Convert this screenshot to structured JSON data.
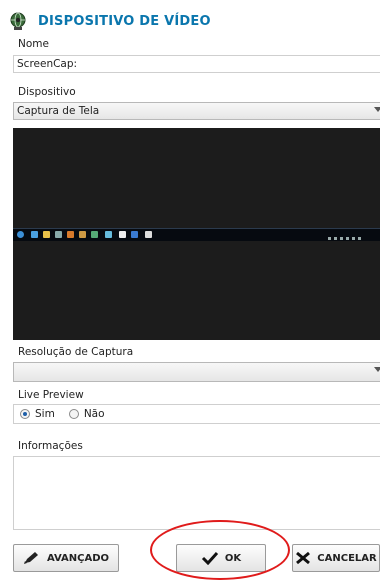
{
  "header": {
    "title": "DISPOSITIVO DE VÍDEO",
    "icon": "webcam-globe-icon"
  },
  "form": {
    "name_label": "Nome",
    "name_value": "ScreenCap:",
    "device_label": "Dispositivo",
    "device_value": "Captura de Tela",
    "resolution_label": "Resolução de Captura",
    "resolution_value": "",
    "live_preview_label": "Live Preview",
    "live_preview_options": [
      "Sim",
      "Não"
    ],
    "live_preview_selected": "Sim",
    "info_label": "Informações",
    "info_value": ""
  },
  "buttons": {
    "advanced": "AVANÇADO",
    "ok": "OK",
    "cancel": "CANCELAR"
  },
  "colors": {
    "title": "#0a76ad",
    "annotation": "#e01b1b"
  }
}
